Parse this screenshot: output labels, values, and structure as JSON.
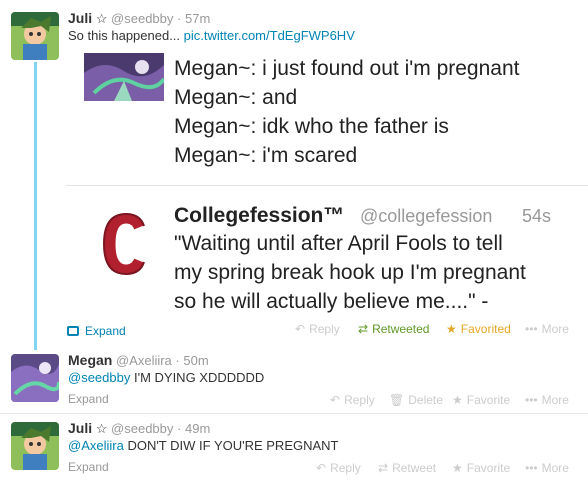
{
  "tweet1": {
    "name": "Juli",
    "star": "☆",
    "handle": "@seedbby",
    "time": "57m",
    "text": "So this happened... ",
    "link": "pic.twitter.com/TdEgFWP6HV",
    "embedded_lines": [
      "Megan~: i just found out i'm pregnant",
      "Megan~: and",
      "Megan~: idk who the father is",
      "Megan~: i'm scared"
    ],
    "quoted": {
      "name": "Collegefession™",
      "handle": "@collegefession",
      "time": "54s",
      "lines": [
        "\"Waiting until after April Fools to tell",
        "my spring break hook up I'm pregnant",
        "so he will actually believe me....\" -"
      ]
    },
    "expand": "Expand",
    "actions": {
      "reply": "Reply",
      "retweet": "Retweeted",
      "favorite": "Favorited",
      "more": "More"
    }
  },
  "tweet2": {
    "name": "Megan",
    "handle": "@Axeliira",
    "time": "50m",
    "mention": "@seedbby",
    "text": " I'M DYING XDDDDDD",
    "expand": "Expand",
    "actions": {
      "reply": "Reply",
      "delete": "Delete",
      "favorite": "Favorite",
      "more": "More"
    }
  },
  "tweet3": {
    "name": "Juli",
    "star": "☆",
    "handle": "@seedbby",
    "time": "49m",
    "mention": "@Axeliira",
    "text": " DON'T DIW IF YOU'RE PREGNANT",
    "expand": "Expand",
    "actions": {
      "reply": "Reply",
      "retweet": "Retweet",
      "favorite": "Favorite",
      "more": "More"
    }
  },
  "colors": {
    "link": "#0084b4",
    "retweeted": "#609928",
    "favorited": "#e5a727",
    "thread_line": "#7fd4f2"
  },
  "icons": {
    "reply": "reply-icon",
    "retweet": "retweet-icon",
    "favorite": "star-icon",
    "more": "more-dots-icon",
    "delete": "trash-icon",
    "expand": "media-icon"
  }
}
